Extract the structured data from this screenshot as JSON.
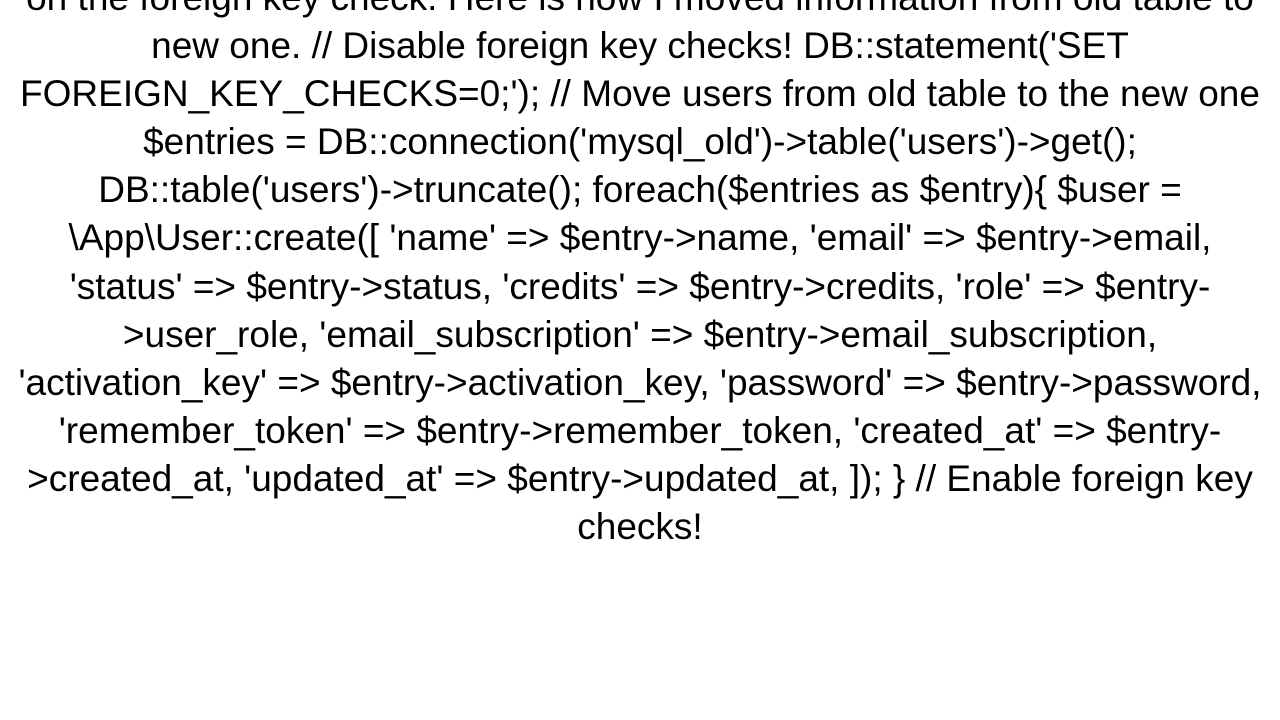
{
  "document": {
    "body_text": "on the foreign key check. Here is how I moved information from old table to new one. // Disable foreign key checks! DB::statement('SET FOREIGN_KEY_CHECKS=0;');  // Move users from old table to the new one $entries = DB::connection('mysql_old')->table('users')->get(); DB::table('users')->truncate(); foreach($entries as $entry){     $user = \\App\\User::create([         'name' => $entry->name,         'email' => $entry->email,         'status' => $entry->status,         'credits' => $entry->credits,         'role' => $entry->user_role,         'email_subscription' => $entry->email_subscription,         'activation_key' => $entry->activation_key,         'password' => $entry->password,         'remember_token' => $entry->remember_token,         'created_at' => $entry->created_at,         'updated_at' => $entry->updated_at,     ]); }  // Enable foreign key checks!"
  }
}
